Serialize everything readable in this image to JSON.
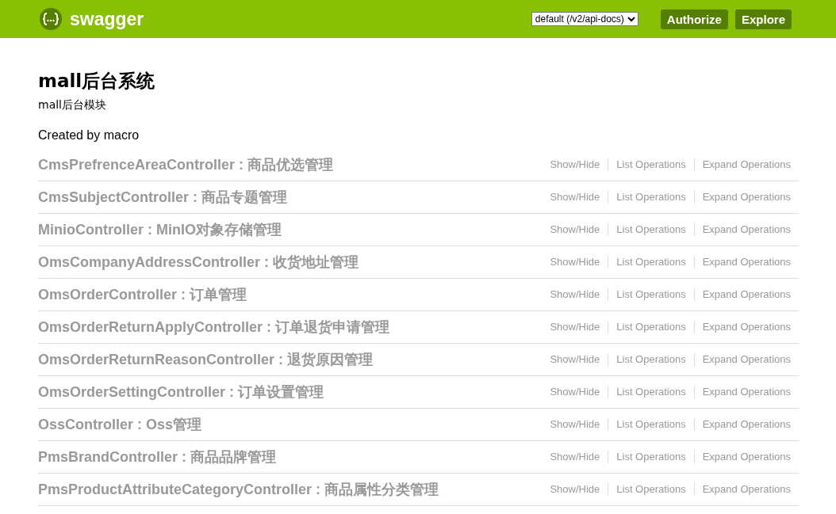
{
  "header": {
    "brand": "swagger",
    "spec_select": {
      "value": "default (/v2/api-docs)"
    },
    "buttons": [
      "Authorize",
      "Explore"
    ]
  },
  "info": {
    "title": "mall后台系统",
    "description": "mall后台模块",
    "created_by": "Created by macro"
  },
  "resources": [
    {
      "name": "CmsPrefrenceAreaController : 商品优选管理",
      "actions": [
        "Show/Hide",
        "List Operations",
        "Expand Operations"
      ]
    },
    {
      "name": "CmsSubjectController : 商品专题管理",
      "actions": [
        "Show/Hide",
        "List Operations",
        "Expand Operations"
      ]
    },
    {
      "name": "MinioController : MinIO对象存储管理",
      "actions": [
        "Show/Hide",
        "List Operations",
        "Expand Operations"
      ]
    },
    {
      "name": "OmsCompanyAddressController : 收货地址管理",
      "actions": [
        "Show/Hide",
        "List Operations",
        "Expand Operations"
      ]
    },
    {
      "name": "OmsOrderController : 订单管理",
      "actions": [
        "Show/Hide",
        "List Operations",
        "Expand Operations"
      ]
    },
    {
      "name": "OmsOrderReturnApplyController : 订单退货申请管理",
      "actions": [
        "Show/Hide",
        "List Operations",
        "Expand Operations"
      ]
    },
    {
      "name": "OmsOrderReturnReasonController : 退货原因管理",
      "actions": [
        "Show/Hide",
        "List Operations",
        "Expand Operations"
      ]
    },
    {
      "name": "OmsOrderSettingController : 订单设置管理",
      "actions": [
        "Show/Hide",
        "List Operations",
        "Expand Operations"
      ]
    },
    {
      "name": "OssController : Oss管理",
      "actions": [
        "Show/Hide",
        "List Operations",
        "Expand Operations"
      ]
    },
    {
      "name": "PmsBrandController : 商品品牌管理",
      "actions": [
        "Show/Hide",
        "List Operations",
        "Expand Operations"
      ]
    },
    {
      "name": "PmsProductAttributeCategoryController : 商品属性分类管理",
      "actions": [
        "Show/Hide",
        "List Operations",
        "Expand Operations"
      ]
    }
  ]
}
